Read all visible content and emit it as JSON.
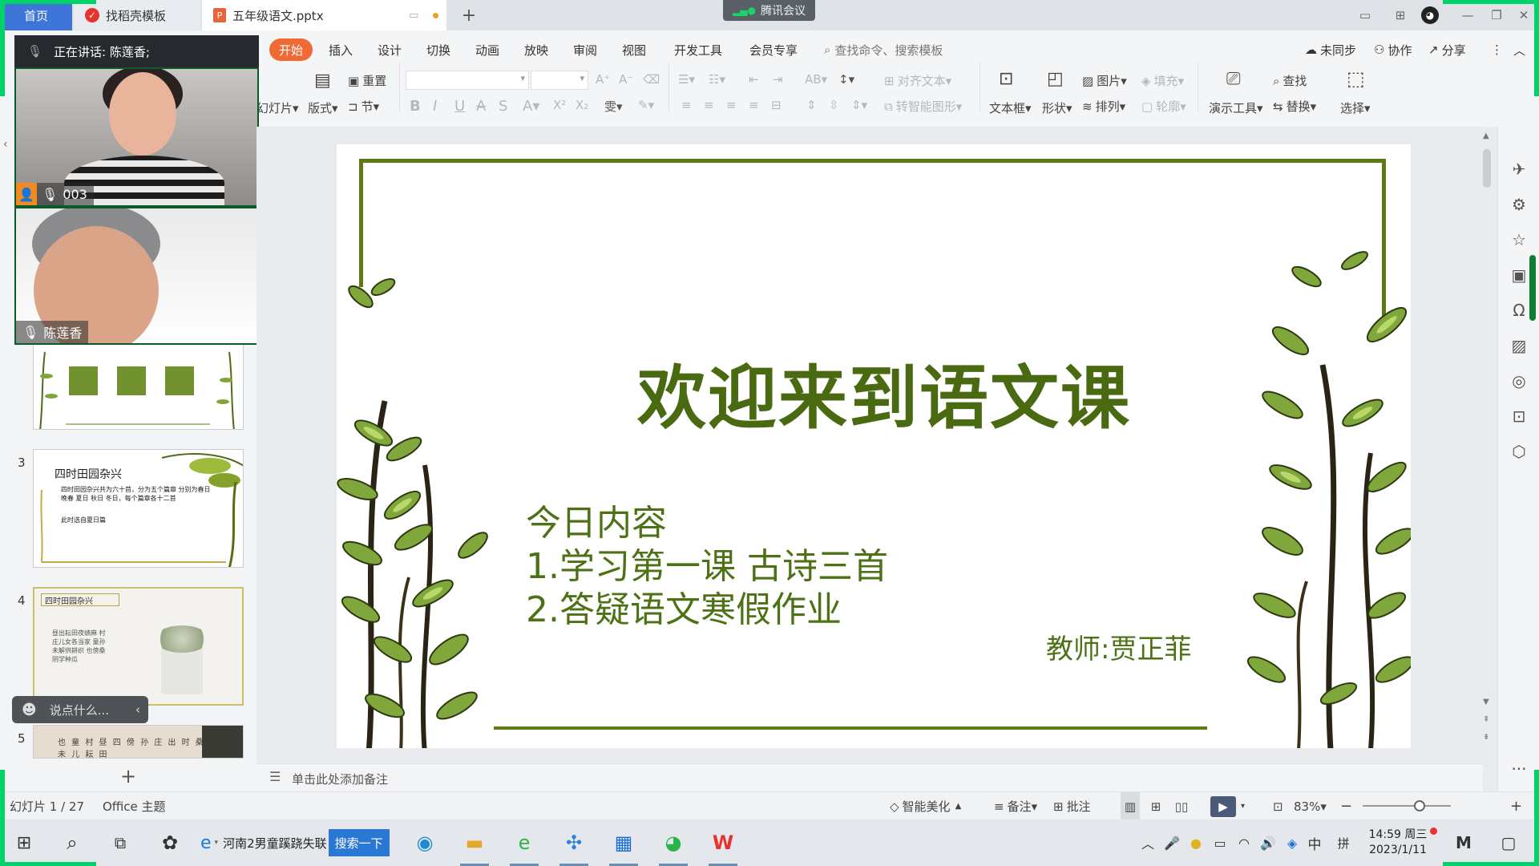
{
  "tabs": {
    "home": "首页",
    "template": "找稻壳模板",
    "document": "五年级语文.pptx",
    "add": "+"
  },
  "meeting_badge": "腾讯会议",
  "ribbon": {
    "tabs": [
      "开始",
      "插入",
      "设计",
      "切换",
      "动画",
      "放映",
      "审阅",
      "视图",
      "开发工具",
      "会员专享"
    ],
    "search_placeholder": "查找命令、搜索模板",
    "sync": "未同步",
    "collab": "协作",
    "share": "分享",
    "tools": {
      "new_slide": "幻灯片",
      "layout": "版式",
      "reset": "重置",
      "section": "节",
      "align_text": "对齐文本",
      "smart_art": "转智能图形",
      "textbox": "文本框",
      "shape": "形状",
      "picture": "图片",
      "arrange": "排列",
      "fill": "填充",
      "outline": "轮廓",
      "present_tools": "演示工具",
      "find": "查找",
      "replace": "替换",
      "select": "选择"
    }
  },
  "meeting": {
    "speaking": "正在讲话: 陈莲香;",
    "participant1": "003",
    "participant2": "陈莲香"
  },
  "thumbnails": [
    {
      "num": "3",
      "title": "四时田园杂兴",
      "line1": "四时田园杂兴共为六十首，分为五个篇章 分别为春日 晚春 夏日 秋日 冬日，每个篇章各十二首",
      "line2": "此时选自夏日篇"
    },
    {
      "num": "4",
      "title": "四时田园杂兴",
      "poem": "昼出耘田夜绩麻 村庄儿女各当家 童孙未解供耕织 也傍桑阴学种瓜"
    },
    {
      "num": "5",
      "chars": "也 童 村 昼 四 傍 孙 庄 出 时 桑 未 儿 耘 田"
    }
  ],
  "chat_placeholder": "说点什么...",
  "slide": {
    "title": "欢迎来到语文课",
    "content_heading": "今日内容",
    "item1": "1.学习第一课 古诗三首",
    "item2": "2.答疑语文寒假作业",
    "teacher": "教师:贾正菲"
  },
  "notes_placeholder": "单击此处添加备注",
  "status": {
    "slide_info": "幻灯片 1 / 27",
    "theme": "Office 主题",
    "beautify": "智能美化",
    "notes": "备注",
    "comment": "批注",
    "zoom": "83%"
  },
  "taskbar": {
    "ie_label": "河南2男童蹊跷失联",
    "search_button": "搜索一下",
    "time": "14:59 周三",
    "date": "2023/1/11",
    "ime_lang": "中",
    "ime_mode": "拼"
  },
  "colors": {
    "accent_orange": "#f06a35",
    "slide_green": "#4a6a12",
    "text_green": "#4d7216",
    "meeting_green": "#00d26a"
  }
}
